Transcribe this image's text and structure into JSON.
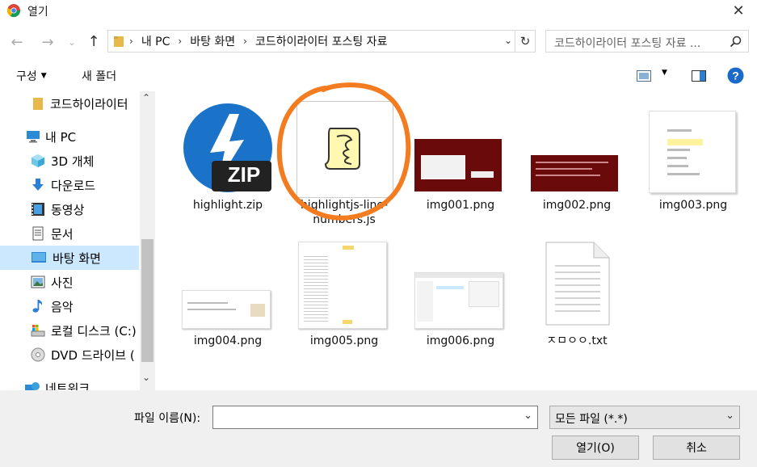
{
  "window": {
    "title": "열기"
  },
  "address": {
    "crumbs": [
      "내 PC",
      "바탕 화면",
      "코드하이라이터 포스팅 자료"
    ]
  },
  "search": {
    "placeholder": "코드하이라이터 포스팅 자료 ..."
  },
  "toolbar": {
    "organize_label": "구성",
    "new_folder_label": "새 폴더"
  },
  "sidebar": {
    "items": [
      {
        "label": "코드하이라이터",
        "icon": "folder-icon"
      },
      {
        "label": "내 PC",
        "icon": "pc-icon"
      },
      {
        "label": "3D 개체",
        "icon": "cube-icon"
      },
      {
        "label": "다운로드",
        "icon": "download-icon"
      },
      {
        "label": "동영상",
        "icon": "video-icon"
      },
      {
        "label": "문서",
        "icon": "document-icon"
      },
      {
        "label": "바탕 화면",
        "icon": "desktop-icon"
      },
      {
        "label": "사진",
        "icon": "picture-icon"
      },
      {
        "label": "음악",
        "icon": "music-icon"
      },
      {
        "label": "로컬 디스크 (C:)",
        "icon": "disk-icon"
      },
      {
        "label": "DVD 드라이브 (",
        "icon": "dvd-icon"
      },
      {
        "label": "네트워크",
        "icon": "network-icon"
      }
    ],
    "selected": "바탕 화면"
  },
  "files": [
    {
      "name": "highlight.zip",
      "type": "zip",
      "badge": "ZIP"
    },
    {
      "name": "highlightjs-line-numbers.js",
      "type": "script"
    },
    {
      "name": "img001.png",
      "type": "image"
    },
    {
      "name": "img002.png",
      "type": "image"
    },
    {
      "name": "img003.png",
      "type": "image"
    },
    {
      "name": "img004.png",
      "type": "image"
    },
    {
      "name": "img005.png",
      "type": "image"
    },
    {
      "name": "img006.png",
      "type": "image"
    },
    {
      "name": "ㅈㅁㅇㅇ.txt",
      "type": "text"
    }
  ],
  "bottom": {
    "filename_label": "파일 이름(N):",
    "filename_value": "",
    "filter_value": "모든 파일 (*.*)",
    "open_label": "열기(O)",
    "cancel_label": "취소"
  },
  "colors": {
    "accent": "#0078d7",
    "selection": "#cce8ff",
    "highlight_circle": "#f47c20"
  }
}
